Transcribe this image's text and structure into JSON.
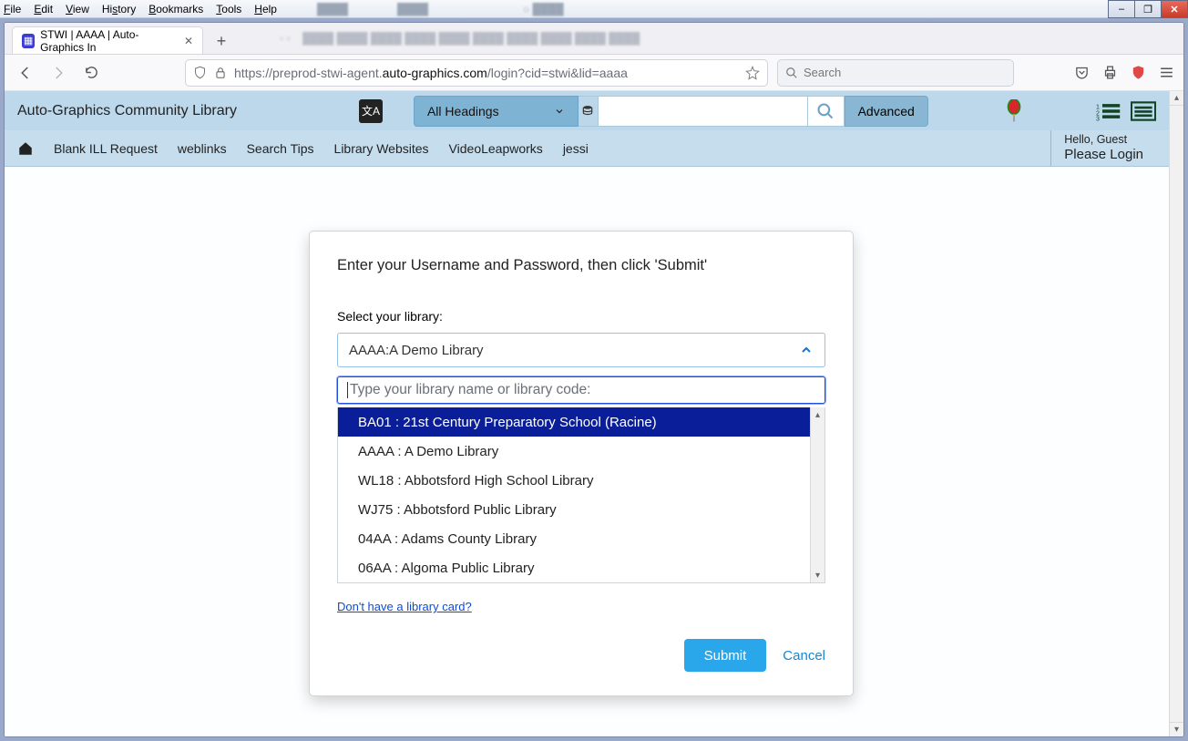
{
  "os_menu": {
    "items": [
      "File",
      "Edit",
      "View",
      "History",
      "Bookmarks",
      "Tools",
      "Help"
    ]
  },
  "window_buttons": {
    "min": "–",
    "max": "❐",
    "close": "✕"
  },
  "tab": {
    "title": "STWI | AAAA | Auto-Graphics In"
  },
  "url": {
    "prefix": "https://preprod-stwi-agent.",
    "host": "auto-graphics.com",
    "path": "/login?cid=stwi&lid=aaaa"
  },
  "browser_search": {
    "placeholder": "Search"
  },
  "site": {
    "brand": "Auto-Graphics Community Library",
    "heading_dropdown": "All Headings",
    "advanced": "Advanced",
    "nav": [
      "Blank ILL Request",
      "weblinks",
      "Search Tips",
      "Library Websites",
      "VideoLeapworks",
      "jessi"
    ],
    "greeting": "Hello, Guest",
    "login": "Please Login"
  },
  "dialog": {
    "title": "Enter your Username and Password, then click 'Submit'",
    "select_label": "Select your library:",
    "selected": "AAAA:A Demo Library",
    "filter_placeholder": "Type your library name or library code:",
    "options": [
      "BA01 : 21st Century Preparatory School (Racine)",
      "AAAA : A Demo Library",
      "WL18 : Abbotsford High School Library",
      "WJ75 : Abbotsford Public Library",
      "04AA : Adams County Library",
      "06AA : Algoma Public Library"
    ],
    "no_card": "Don't have a library card?",
    "submit": "Submit",
    "cancel": "Cancel"
  }
}
